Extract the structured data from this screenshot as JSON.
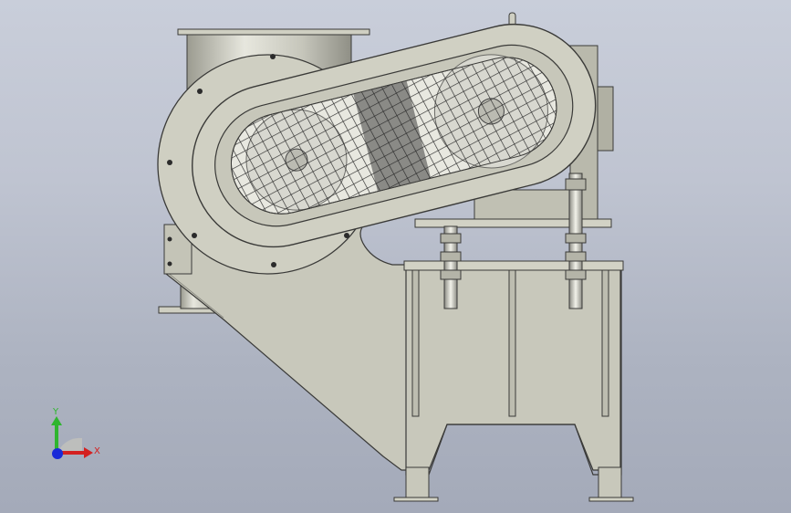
{
  "viewport": {
    "background_top": "#c9ceda",
    "background_bottom": "#a4aab9"
  },
  "model": {
    "part_fill": "#cfcfc2",
    "part_fill_dark": "#b8b8aa",
    "edge_color": "#3a3a38",
    "mesh_color": "#2a2a2a",
    "hole_color": "#2b2b2b"
  },
  "triad": {
    "y_label": "Y",
    "x_label": "X",
    "y_color": "#2fb52f",
    "x_color": "#d42020",
    "z_color": "#1a2ad8"
  }
}
